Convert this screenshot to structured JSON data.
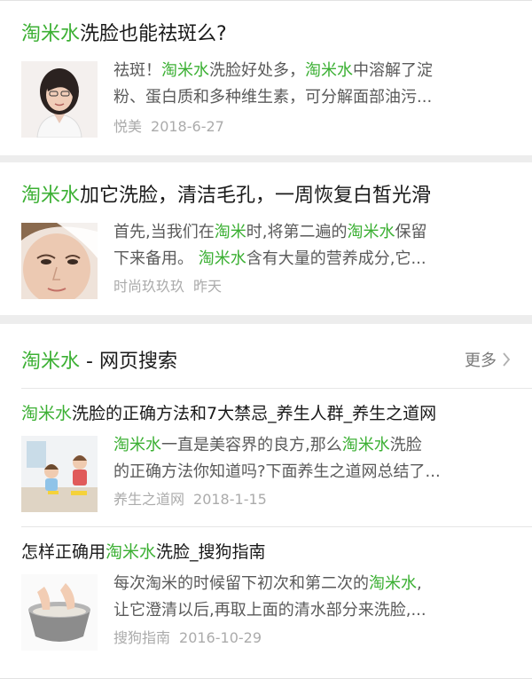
{
  "articles": [
    {
      "title_hl": "淘米水",
      "title_rest": "洗脸也能祛斑么?",
      "snippet_line1": [
        {
          "t": "祛斑！",
          "hl": false
        },
        {
          "t": "淘米水",
          "hl": true
        },
        {
          "t": "洗脸好处多，",
          "hl": false
        },
        {
          "t": "淘米水",
          "hl": true
        },
        {
          "t": "中溶解了淀",
          "hl": false
        }
      ],
      "snippet_line2": "粉、蛋白质和多种维生素，可分解面部油污...",
      "source": "悦美",
      "date": "2018-6-27",
      "thumb_icon": "woman-portrait-icon"
    },
    {
      "title_hl": "淘米水",
      "title_rest": "加它洗脸，清洁毛孔，一周恢复白皙光滑",
      "snippet_line1": [
        {
          "t": "首先,当我们在",
          "hl": false
        },
        {
          "t": "淘米",
          "hl": true
        },
        {
          "t": "时,将第二遍的",
          "hl": false
        },
        {
          "t": "淘米水",
          "hl": true
        },
        {
          "t": "保留",
          "hl": false
        }
      ],
      "snippet_line2_parts": [
        {
          "t": "下来备用。 ",
          "hl": false
        },
        {
          "t": "淘米水",
          "hl": true
        },
        {
          "t": "含有大量的营养成分,它...",
          "hl": false
        }
      ],
      "source": "时尚玖玖玖",
      "date": "昨天",
      "thumb_icon": "face-care-icon"
    }
  ],
  "web_search": {
    "heading_hl": "淘米水",
    "heading_rest": " - 网页搜索",
    "more_label": "更多",
    "results": [
      {
        "title_parts": [
          {
            "t": "淘米水",
            "hl": true
          },
          {
            "t": "洗脸的正确方法和7大禁忌_养生人群_养生之道网",
            "hl": false
          }
        ],
        "line1": [
          {
            "t": "淘米水",
            "hl": true
          },
          {
            "t": "一直是美容界的良方,那么",
            "hl": false
          },
          {
            "t": "淘米水",
            "hl": true
          },
          {
            "t": "洗脸",
            "hl": false
          }
        ],
        "line2": "的正确方法你知道吗?下面养生之道网总结了...",
        "source": "养生之道网",
        "date": "2018-1-15",
        "thumb_icon": "kids-cleaning-icon"
      },
      {
        "title_parts": [
          {
            "t": "怎样正确用",
            "hl": false
          },
          {
            "t": "淘米水",
            "hl": true
          },
          {
            "t": "洗脸_搜狗指南",
            "hl": false
          }
        ],
        "line1": [
          {
            "t": "每次淘米的时候留下初次和第二次的",
            "hl": false
          },
          {
            "t": "淘米水",
            "hl": true
          },
          {
            "t": ",",
            "hl": false
          }
        ],
        "line2": "让它澄清以后,再取上面的清水部分来洗脸,...",
        "source": "搜狗指南",
        "date": "2016-10-29",
        "thumb_icon": "rice-washing-icon"
      }
    ]
  },
  "colors": {
    "highlight": "#3cb034",
    "snippet": "#5a5a5a",
    "meta": "#ababab",
    "background": "#ededed"
  }
}
